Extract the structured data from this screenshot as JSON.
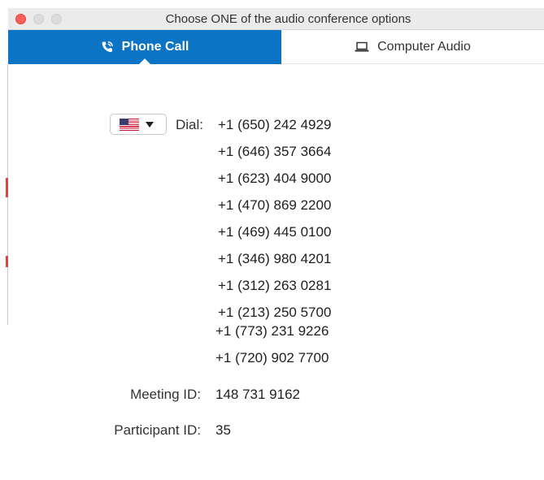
{
  "window": {
    "title": "Choose ONE of the audio conference options"
  },
  "tabs": [
    {
      "label": "Phone Call",
      "icon": "phone-icon",
      "active": true
    },
    {
      "label": "Computer Audio",
      "icon": "laptop-icon",
      "active": false
    }
  ],
  "dial": {
    "country": "United States",
    "label": "Dial:",
    "numbers": [
      "+1 (650) 242 4929",
      "+1 (646) 357 3664",
      "+1 (623) 404 9000",
      "+1 (470) 869 2200",
      "+1 (469) 445 0100",
      "+1 (346) 980 4201",
      "+1 (312) 263 0281",
      "+1 (213) 250 5700",
      "+1 (773) 231 9226",
      "+1 (720) 902 7700"
    ]
  },
  "meeting": {
    "id_label": "Meeting ID:",
    "id_value": "148 731 9162",
    "participant_label": "Participant ID:",
    "participant_value": "35"
  },
  "colors": {
    "accent": "#0b74c4",
    "close_button": "#fc5f57"
  }
}
